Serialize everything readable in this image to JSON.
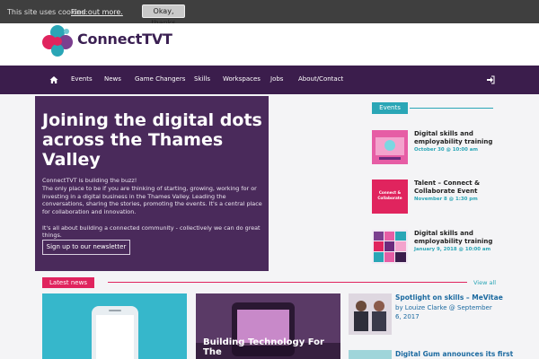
{
  "cookie": {
    "text": "This site uses cookies:",
    "link": "Find out more.",
    "button": "Okay, thanks"
  },
  "brand": {
    "name": "ConnectTVT"
  },
  "nav": {
    "items": [
      "Events",
      "News",
      "Game Changers",
      "Skills",
      "Workspaces",
      "Jobs",
      "About/Contact"
    ],
    "home_icon": "home-icon",
    "login_icon": "sign-in-icon"
  },
  "hero": {
    "title": "Joining the digital dots across the Thames Valley",
    "intro_1": "ConnectTVT is building the buzz!",
    "intro_2": "The only place to be if you are thinking of starting, growing, working for or investing in a digital business in the Thames Valley. Leading the conversations, sharing the stories, promoting the events. It's a central place for collaboration and innovation.",
    "tagline": "It's all about building a connected community - collectively we can do great things.",
    "button": "Sign up to our newsletter"
  },
  "events": {
    "label": "Events",
    "items": [
      {
        "title": "Digital skills and employability training",
        "date": "October 30 @ 10:00 am"
      },
      {
        "title": "Talent – Connect & Collaborate Event",
        "date": "November 8 @ 1:30 pm",
        "thumb_text": "Connect & Collaborate"
      },
      {
        "title": "Digital skills and employability training",
        "date": "January 9, 2018 @ 10:00 am"
      }
    ]
  },
  "news": {
    "label": "Latest news",
    "view_all": "View all",
    "cards": [
      {
        "caption": ""
      },
      {
        "caption": "Building Technology For The"
      }
    ],
    "side": [
      {
        "title": "Spotlight on skills – MeVitae",
        "byline": "by Louize Clarke @ September 6, 2017"
      },
      {
        "title": "Digital Gum announces its first",
        "byline": ""
      }
    ]
  },
  "colors": {
    "nav_bg": "#3b1d4c",
    "hero_bg": "#4a2a5b",
    "accent_teal": "#2aa6b6",
    "accent_pink": "#e0245e"
  }
}
